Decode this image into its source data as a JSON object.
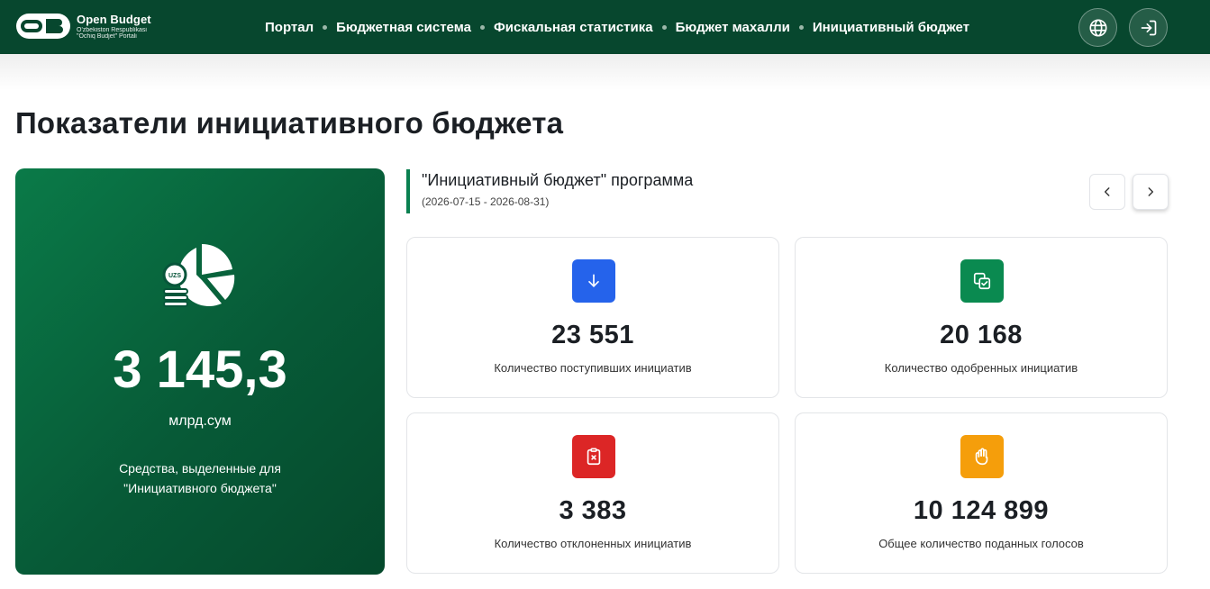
{
  "header": {
    "logo_title": "Open Budget",
    "logo_sub1": "O'zbekiston Respublikasi",
    "logo_sub2": "\"Ochiq Budjet\" Portali",
    "nav": [
      "Портал",
      "Бюджетная система",
      "Фискальная статистика",
      "Бюджет махалли",
      "Инициативный бюджет"
    ]
  },
  "page": {
    "title": "Показатели инициативного бюджета"
  },
  "hero": {
    "icon_text": "UZS",
    "value": "3 145,3",
    "unit": "млрд.сум",
    "description": "Средства, выделенные для \"Инициативного бюджета\""
  },
  "program": {
    "title": "\"Инициативный бюджет\" программа",
    "dates": "(2026-07-15 - 2026-08-31)"
  },
  "stats": [
    {
      "value": "23 551",
      "label": "Количество поступивших инициатив",
      "icon": "arrow-down-icon",
      "color": "#2563eb"
    },
    {
      "value": "20 168",
      "label": "Количество одобренных инициатив",
      "icon": "copy-check-icon",
      "color": "#0a8a50"
    },
    {
      "value": "3 383",
      "label": "Количество отклоненных инициатив",
      "icon": "clipboard-x-icon",
      "color": "#dc2626"
    },
    {
      "value": "10 124 899",
      "label": "Общее количество поданных голосов",
      "icon": "hand-icon",
      "color": "#f59e0b"
    }
  ],
  "colors": {
    "header_bg": "#07472e",
    "accent": "#0a8050"
  }
}
